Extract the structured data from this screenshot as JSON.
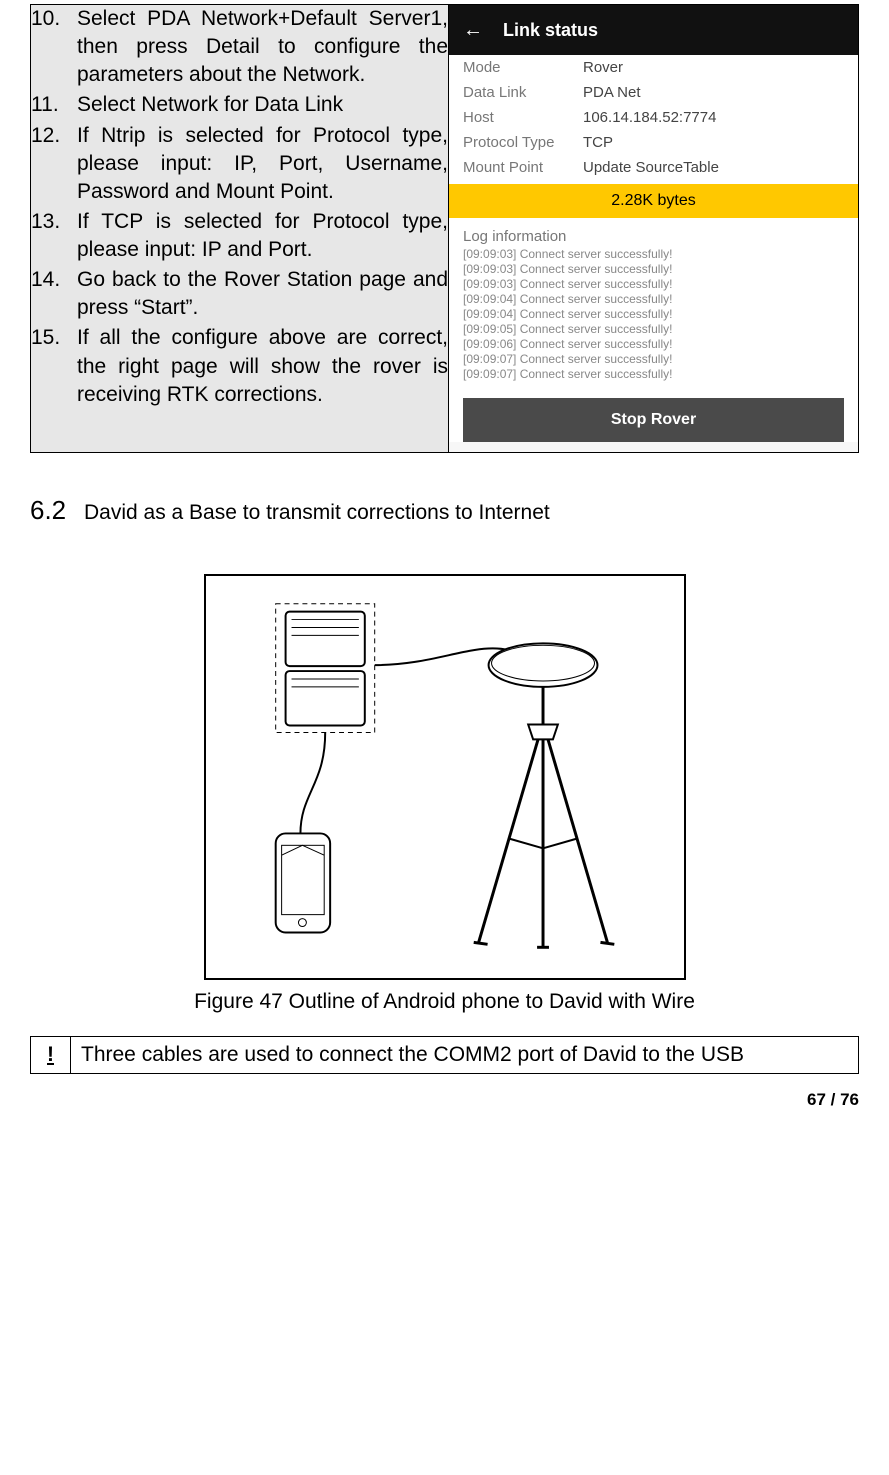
{
  "steps": [
    "Select PDA Network+Default Server1, then press Detail to configure the parameters about the Network.",
    "Select Network for Data Link",
    "If Ntrip is selected for Protocol type, please input: IP, Port, Username, Password and Mount Point.",
    "If TCP is selected for Protocol type, please input: IP and Port.",
    "Go back to the Rover Station page and press “Start”.",
    "If all the configure above are correct, the right page will show the rover is receiving RTK corrections."
  ],
  "phone": {
    "title": "Link status",
    "mode_k": "Mode",
    "mode_v": "Rover",
    "datalink_k": "Data Link",
    "datalink_v": "PDA Net",
    "host_k": "Host",
    "host_v": "106.14.184.52:7774",
    "prot_k": "Protocol Type",
    "prot_v": "TCP",
    "mount_k": "Mount Point",
    "mount_v": "Update SourceTable",
    "bytes": "2.28K bytes",
    "log_head": "Log information",
    "log": [
      "[09:09:03] Connect server successfully!",
      "[09:09:03] Connect server successfully!",
      "[09:09:03] Connect server successfully!",
      "[09:09:04] Connect server successfully!",
      "[09:09:04] Connect server successfully!",
      "[09:09:05] Connect server successfully!",
      "[09:09:06] Connect server successfully!",
      "[09:09:07] Connect server successfully!",
      "[09:09:07] Connect server successfully!"
    ],
    "stop": "Stop Rover"
  },
  "section": {
    "num": "6.2",
    "title": "David as a Base to transmit corrections to Internet"
  },
  "caption": "Figure 47 Outline of Android phone to David with Wire",
  "note_icon": "!",
  "note_text": "Three cables are used to connect the COMM2 port of David to the USB",
  "page": "67 / 76"
}
